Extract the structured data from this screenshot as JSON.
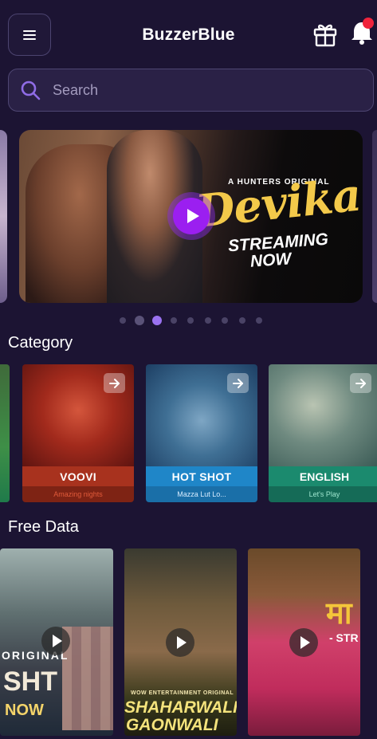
{
  "header": {
    "title": "BuzzerBlue",
    "menu_icon": "hamburger-menu-icon",
    "gift_icon": "gift-icon",
    "bell_icon": "notification-bell-icon",
    "accent_color": "#8a5cf0",
    "badge_color": "#f0243c"
  },
  "search": {
    "placeholder": "Search",
    "icon": "search-icon"
  },
  "banner": {
    "tagline": "A HUNTERS ORIGINAL",
    "show_title": "Devika",
    "streaming_line1": "STREAMING",
    "streaming_line2": "NOW",
    "play_icon": "play-icon",
    "dots_count": 9,
    "active_dot_index": 2
  },
  "categories": {
    "section_title": "Category",
    "items": [
      {
        "label": "VOOVI",
        "subtitle": "Amazing nights",
        "band_color": "#a8321e",
        "sub_color": "#7e2314",
        "sub_text_color": "#e05a3a"
      },
      {
        "label": "HOT SHOT",
        "subtitle": "Mazza Lut Lo...",
        "band_color": "#1f86c8",
        "sub_color": "#1a6fa8",
        "sub_text_color": "#d7ecff"
      },
      {
        "label": "ENGLISH",
        "subtitle": "Let's Play",
        "band_color": "#1b8a6e",
        "sub_color": "#156b57",
        "sub_text_color": "#9ee6cf"
      }
    ]
  },
  "free_data": {
    "section_title": "Free Data",
    "items": [
      {
        "overlay_text_1": "ORIGINAL",
        "overlay_text_2": "SHT",
        "overlay_text_3": "NOW"
      },
      {
        "overlay_text_1": "WOW ENTERTAINMENT ORIGINAL",
        "overlay_text_2": "SHAHARWALI",
        "overlay_text_3": "GAONWALI"
      },
      {
        "overlay_text_1": "मा",
        "overlay_text_2": "- STR",
        "overlay_text_3": ""
      }
    ]
  }
}
